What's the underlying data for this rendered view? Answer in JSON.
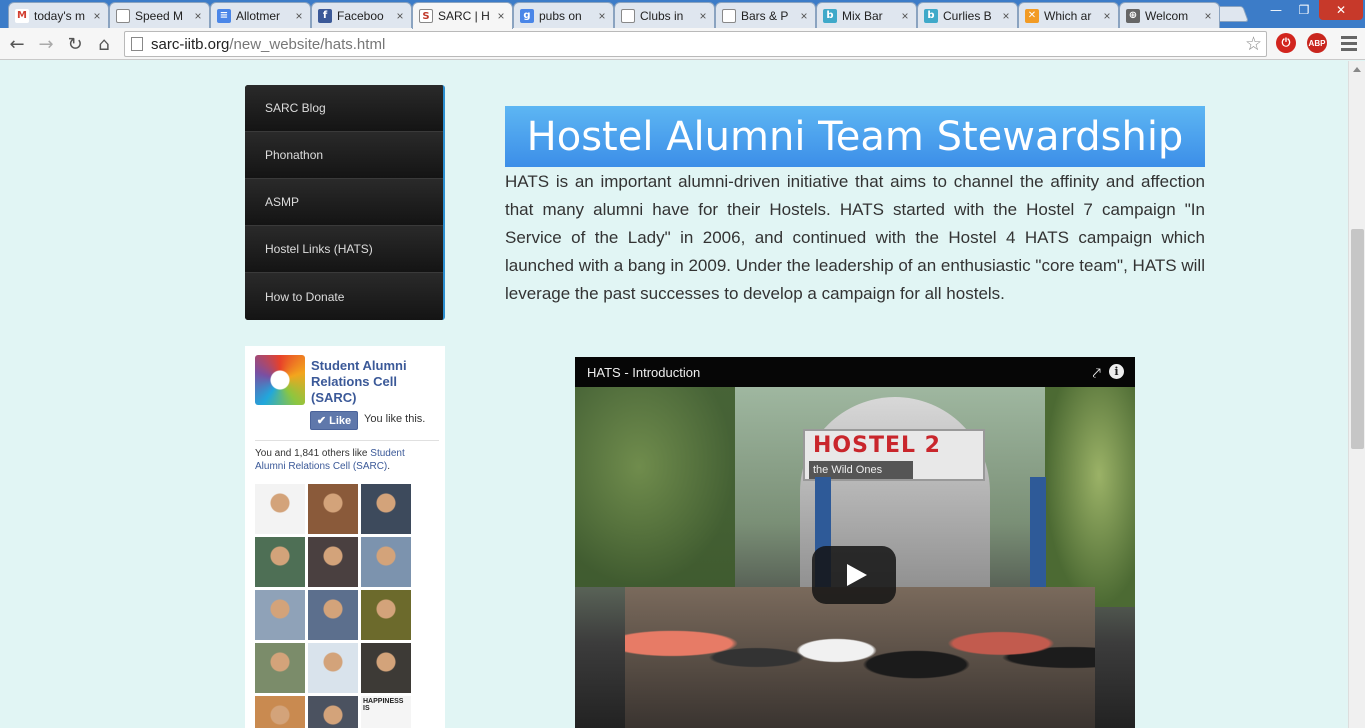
{
  "browser": {
    "tabs": [
      {
        "label": "today's m",
        "favicon": "gmail-icon",
        "color": "#d23f31",
        "glyph": "M"
      },
      {
        "label": "Speed M",
        "favicon": "page-icon",
        "color": "#ffffff",
        "glyph": ""
      },
      {
        "label": "Allotmer",
        "favicon": "google-docs-icon",
        "color": "#4a86e8",
        "glyph": "≡"
      },
      {
        "label": "Faceboo",
        "favicon": "facebook-icon",
        "color": "#3b5998",
        "glyph": "f"
      },
      {
        "label": "SARC | H",
        "favicon": "sarc-icon",
        "color": "#ffffff",
        "glyph": "S",
        "active": true
      },
      {
        "label": "pubs on",
        "favicon": "google-icon",
        "color": "#4a86e8",
        "glyph": "g"
      },
      {
        "label": "Clubs in",
        "favicon": "page-icon",
        "color": "#ffffff",
        "glyph": ""
      },
      {
        "label": "Bars & P",
        "favicon": "page-icon",
        "color": "#ffffff",
        "glyph": ""
      },
      {
        "label": "Mix Bar",
        "favicon": "burrp-icon",
        "color": "#3fa9c9",
        "glyph": "b"
      },
      {
        "label": "Curlies B",
        "favicon": "burrp-icon",
        "color": "#3fa9c9",
        "glyph": "b"
      },
      {
        "label": "Which ar",
        "favicon": "tripadvisor-icon",
        "color": "#f29b24",
        "glyph": "✕"
      },
      {
        "label": "Welcom",
        "favicon": "globe-icon",
        "color": "#666666",
        "glyph": "⊕"
      }
    ],
    "window": {
      "minimize": "—",
      "maximize": "❐",
      "close": "✕"
    },
    "nav": {
      "back": "←",
      "forward": "→",
      "reload": "↻",
      "home": "⌂"
    },
    "url": {
      "host": "sarc-iitb.org",
      "path": "/new_website/hats.html"
    },
    "star": "☆",
    "ext_abp": "ABP",
    "ext_power": "⏻"
  },
  "sidebar": {
    "items": [
      {
        "label": "SARC Blog"
      },
      {
        "label": "Phonathon"
      },
      {
        "label": "ASMP"
      },
      {
        "label": "Hostel Links (HATS)"
      },
      {
        "label": "How to Donate"
      }
    ]
  },
  "fb": {
    "page_name": "Student Alumni Relations Cell (SARC)",
    "like_label": "✔ Like",
    "you_like": "You like this.",
    "others_prefix": "You and 1,841 others like ",
    "others_link": "Student Alumni Relations Cell (SARC)",
    "others_suffix": ".",
    "faces": [
      {
        "color": "#f3f3f3"
      },
      {
        "color": "#8a5a3a"
      },
      {
        "color": "#3d4a5c"
      },
      {
        "color": "#4e6f55"
      },
      {
        "color": "#4a4040"
      },
      {
        "color": "#7c93ae"
      },
      {
        "color": "#8fa2b8"
      },
      {
        "color": "#5c6f8d"
      },
      {
        "color": "#6c6a2c"
      },
      {
        "color": "#7b8c6a"
      },
      {
        "color": "#d9e3ec"
      },
      {
        "color": "#3d3a36"
      },
      {
        "color": "#c98a50"
      },
      {
        "color": "#4b5260"
      },
      {
        "color": "#f5f5f5",
        "caption": "HAPPINESS IS"
      }
    ]
  },
  "main": {
    "title": "Hostel Alumni Team Stewardship",
    "paragraph": "HATS is an important alumni-driven initiative that aims to channel the affinity and affection that many alumni have for their Hostels. HATS started with the Hostel 7 campaign \"In Service of the Lady\" in 2006, and continued with the Hostel 4 HATS campaign which launched with a bang in 2009. Under the leadership of an enthusiastic \"core team\", HATS will leverage the past successes to develop a campaign for all hostels.",
    "video": {
      "title": "HATS - Introduction",
      "share": "⤤",
      "info": "i",
      "sign_line1": "HOSTEL 2",
      "sign_line2": "the Wild Ones"
    }
  },
  "colors": {
    "accent": "#2b8ed0",
    "banner": "#4aa3ee",
    "page_bg": "#e1f5f4",
    "fb_blue": "#3b5998"
  }
}
